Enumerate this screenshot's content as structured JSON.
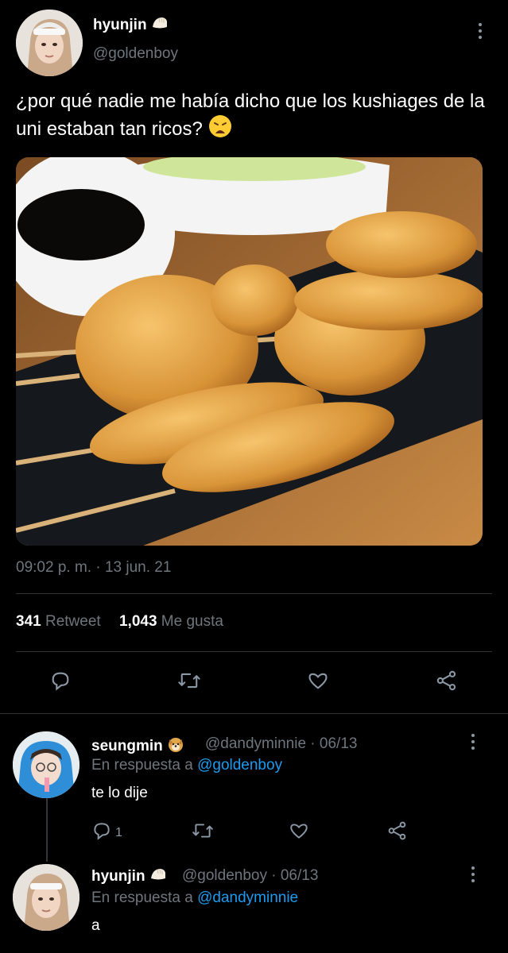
{
  "main_tweet": {
    "display_name": "hyunjin",
    "name_emoji": "dumpling-emoji",
    "handle": "@goldenboy",
    "text": "¿por qué nadie me había dicho que los kushiages de la uni estaban tan ricos?",
    "text_emoji": "weary-face-emoji",
    "timestamp": "09:02 p. m. · 13 jun. 21",
    "retweets_count": "341",
    "retweets_label": "Retweet",
    "likes_count": "1,043",
    "likes_label": "Me gusta",
    "photo_icon": "kushiage-photo"
  },
  "actions": [
    "reply-icon",
    "retweet-icon",
    "like-icon",
    "share-icon"
  ],
  "replies": [
    {
      "display_name": "seungmin",
      "name_emoji": "dog-face-emoji",
      "handle_time": "@dandyminnie · 06/13",
      "reply_to_prefix": "En respuesta a",
      "reply_to_mention": "@goldenboy",
      "text": "te lo dije",
      "reply_count": "1"
    },
    {
      "display_name": "hyunjin",
      "name_emoji": "dumpling-emoji",
      "handle_time": "@goldenboy · 06/13",
      "reply_to_prefix": "En respuesta a",
      "reply_to_mention": "@dandyminnie",
      "text": "a"
    }
  ]
}
